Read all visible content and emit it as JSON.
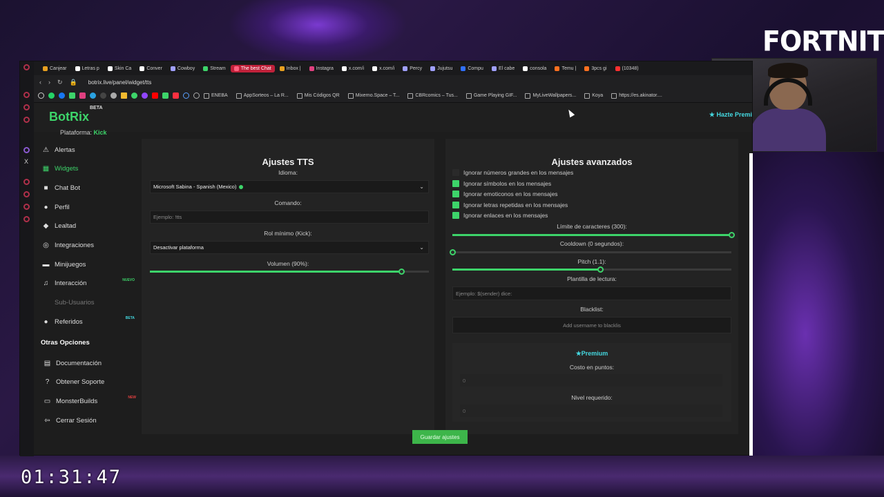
{
  "overlay": {
    "game_title": "FORTNITE",
    "timer": "01:31:47"
  },
  "browser": {
    "tabs": [
      {
        "label": "Canjear",
        "color": "#e8a020"
      },
      {
        "label": "Letras p",
        "color": "#ffffff"
      },
      {
        "label": "Skin Ca",
        "color": "#ffffff"
      },
      {
        "label": "Conver",
        "color": "#ffffff"
      },
      {
        "label": "Cowboy",
        "color": "#a0a0ff"
      },
      {
        "label": "Stream",
        "color": "#3dd46a"
      },
      {
        "label": "The best Chat",
        "color": "#ff6080",
        "active": true
      },
      {
        "label": "Inbox |",
        "color": "#e8a020"
      },
      {
        "label": "Instagra",
        "color": "#e04080"
      },
      {
        "label": "x.com/i",
        "color": "#ffffff"
      },
      {
        "label": "x.com/i",
        "color": "#ffffff"
      },
      {
        "label": "Percy",
        "color": "#a0a0ff"
      },
      {
        "label": "Jujutsu",
        "color": "#a0a0ff"
      },
      {
        "label": "Compu",
        "color": "#3070ff"
      },
      {
        "label": "El cabe",
        "color": "#a0a0ff"
      },
      {
        "label": "consola",
        "color": "#ffffff"
      },
      {
        "label": "Temu |",
        "color": "#ff7020"
      },
      {
        "label": "3pcs gi",
        "color": "#ff7020"
      },
      {
        "label": "(10348)",
        "color": "#ff3030"
      }
    ],
    "url": "botrix.live/panel/widget/tts",
    "bookmarks": [
      "ENEBA",
      "AppSorteos – La R...",
      "Mis Códigos QR",
      "Mixerno.Space – T...",
      "CBRcomics – Tus...",
      "Game Playing GIF...",
      "MyLiveWallpapers...",
      "Koya",
      "https://es.akinator...."
    ]
  },
  "app": {
    "logo": "BotRix",
    "logo_badge": "BETA",
    "platform_label": "Plataforma:",
    "platform_value": "Kick",
    "premium_cta": "Hazte Premi",
    "nav": [
      {
        "label": "Alertas",
        "icon": "warning-icon"
      },
      {
        "label": "Widgets",
        "icon": "grid-icon",
        "active": true
      },
      {
        "label": "Chat Bot",
        "icon": "chat-icon"
      },
      {
        "label": "Perfil",
        "icon": "user-icon"
      },
      {
        "label": "Lealtad",
        "icon": "loyalty-icon"
      },
      {
        "label": "Integraciones",
        "icon": "plug-icon"
      },
      {
        "label": "Minijuegos",
        "icon": "gamepad-icon"
      },
      {
        "label": "Interacción",
        "icon": "music-icon",
        "badge": "NUEVO"
      },
      {
        "label": "Sub-Usuarios",
        "icon": "",
        "muted": true
      },
      {
        "label": "Referidos",
        "icon": "users-icon",
        "badge": "BETA"
      }
    ],
    "other_title": "Otras Opciones",
    "other": [
      {
        "label": "Documentación",
        "icon": "book-icon"
      },
      {
        "label": "Obtener Soporte",
        "icon": "help-icon"
      },
      {
        "label": "MonsterBuilds",
        "icon": "monitor-icon",
        "badge": "NEW"
      },
      {
        "label": "Cerrar Sesión",
        "icon": "logout-icon"
      }
    ]
  },
  "tts": {
    "title": "Ajustes TTS",
    "language_label": "Idioma:",
    "language_value": "Microsoft Sabina - Spanish (Mexico)",
    "command_label": "Comando:",
    "command_placeholder": "Ejemplo: !tts",
    "role_label": "Rol mínimo (Kick):",
    "role_value": "Desactivar plataforma",
    "volume_label": "Volumen (90%):",
    "volume_fraction": 0.9
  },
  "advanced": {
    "title": "Ajustes avanzados",
    "checkboxes": [
      {
        "label": "Ignorar números grandes en los mensajes",
        "checked": false
      },
      {
        "label": "Ignorar símbolos en los mensajes",
        "checked": true
      },
      {
        "label": "Ignorar emoticonos en los mensajes",
        "checked": true
      },
      {
        "label": "Ignorar letras repetidas en los mensajes",
        "checked": true
      },
      {
        "label": "Ignorar enlaces en los mensajes",
        "checked": true
      }
    ],
    "char_limit_label": "Límite de caracteres (300):",
    "char_limit_fraction": 1.0,
    "cooldown_label": "Cooldown (0 segundos):",
    "cooldown_fraction": 0.0,
    "pitch_label": "Pitch (1.1):",
    "pitch_fraction": 0.53,
    "template_label": "Plantilla de lectura:",
    "template_placeholder": "Ejemplo: $(sender) dice:",
    "blacklist_label": "Blacklist:",
    "blacklist_placeholder": "Add username to blacklis",
    "premium_title": "Premium",
    "cost_label": "Costo en puntos:",
    "cost_value": "0",
    "level_label": "Nivel requerido:",
    "level_value": "0"
  },
  "save_label": "Guardar ajustes"
}
